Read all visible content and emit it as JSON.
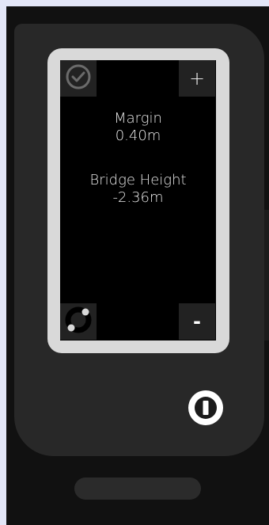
{
  "app": {
    "screen": {
      "margin_label": "Margin",
      "margin_value": "0.40m",
      "bridge_label": "Bridge Height",
      "bridge_value": "-2.36m"
    },
    "controls": {
      "plus_label": "+",
      "minus_label": "-",
      "confirm_icon": "check-circle-icon",
      "rotate_icon": "rotate-icon",
      "power_icon": "power-icon"
    }
  }
}
